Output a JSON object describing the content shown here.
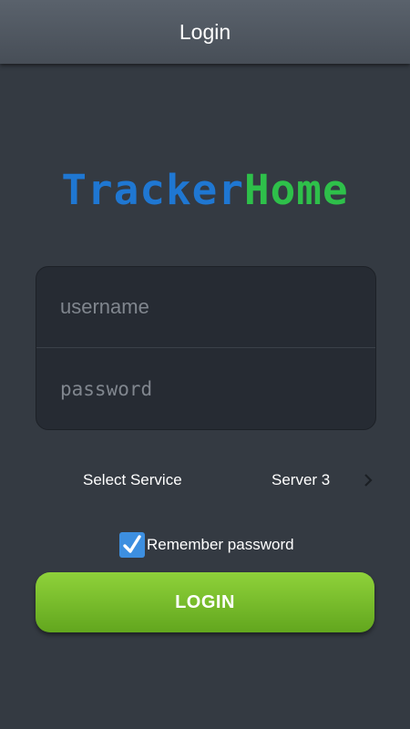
{
  "header": {
    "title": "Login"
  },
  "logo": {
    "part1": "Tracker",
    "part2": "Home",
    "color1": "#1f77d2",
    "color2": "#2ec04a"
  },
  "form": {
    "username_placeholder": "username",
    "username_value": "",
    "password_placeholder": "password",
    "password_value": ""
  },
  "service": {
    "label": "Select Service",
    "value": "Server 3",
    "icon": "chevron-right-icon"
  },
  "remember": {
    "label": "Remember password",
    "checked": true,
    "icon": "check-icon",
    "color": "#3d8fe0"
  },
  "login_button": {
    "label": "LOGIN",
    "color": "#7bc02c"
  }
}
